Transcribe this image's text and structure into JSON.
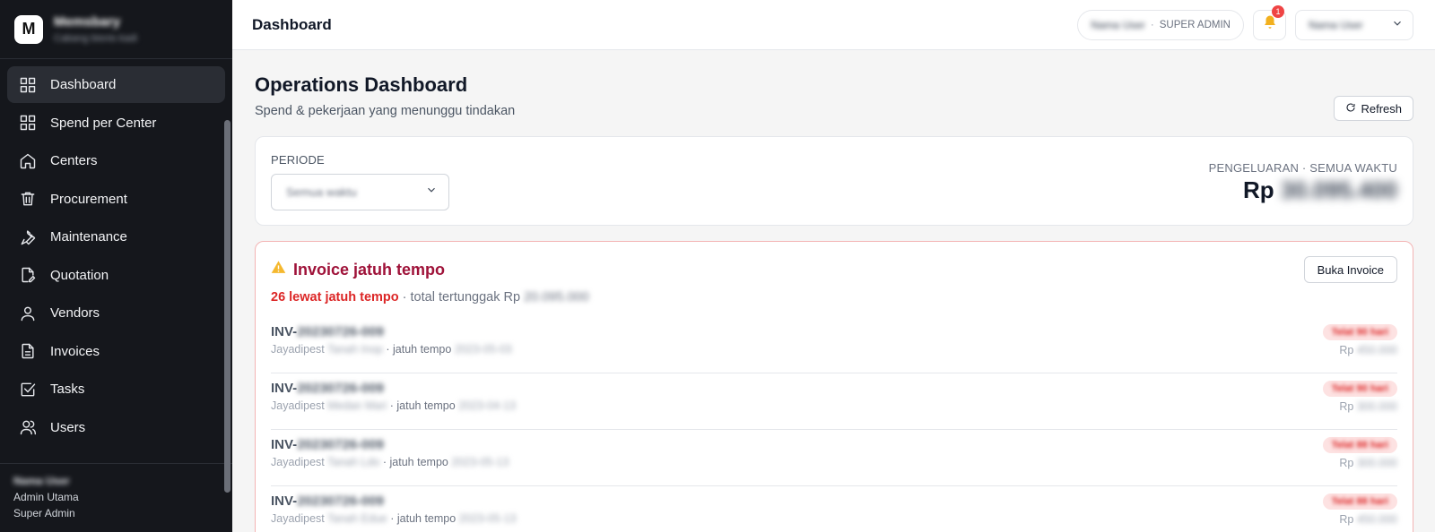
{
  "brand": {
    "logo_letter": "M",
    "name": "Memsbary",
    "subtitle": "Cabang bisnis kadi"
  },
  "sidebar": {
    "items": [
      {
        "label": "Dashboard",
        "icon": "grid-icon",
        "active": true
      },
      {
        "label": "Spend per Center",
        "icon": "grid-icon"
      },
      {
        "label": "Centers",
        "icon": "home-icon"
      },
      {
        "label": "Procurement",
        "icon": "trash-icon"
      },
      {
        "label": "Maintenance",
        "icon": "wrench-icon"
      },
      {
        "label": "Quotation",
        "icon": "file-edit-icon"
      },
      {
        "label": "Vendors",
        "icon": "user-icon"
      },
      {
        "label": "Invoices",
        "icon": "file-text-icon"
      },
      {
        "label": "Tasks",
        "icon": "checkbox-icon"
      },
      {
        "label": "Users",
        "icon": "users-icon"
      }
    ],
    "footer": {
      "name": "Nama User",
      "org": "Admin Utama",
      "role": "Super Admin"
    }
  },
  "topbar": {
    "title": "Dashboard",
    "user_name": "Nama User",
    "role_sep": "·",
    "role": "SUPER ADMIN",
    "notification_count": "1",
    "account_select": "Nama User"
  },
  "page": {
    "title": "Operations Dashboard",
    "subtitle": "Spend & pekerjaan yang menunggu tindakan",
    "refresh_label": "Refresh"
  },
  "period": {
    "label": "PERIODE",
    "selected": "Semua waktu",
    "spend_label": "PENGELUARAN · SEMUA WAKTU",
    "spend_prefix": "Rp",
    "spend_value": "30.095.400"
  },
  "invoices": {
    "title": "Invoice jatuh tempo",
    "open_button": "Buka Invoice",
    "overdue_text": "26 lewat jatuh tempo",
    "total_text": "· total tertunggak Rp",
    "total_value": "20.095.000",
    "rows": [
      {
        "prefix": "INV-",
        "number": "20230726-009",
        "vendor": "Jayadipest",
        "center": "Tanah Inop",
        "due_label": "· jatuh tempo",
        "due": "2023-05-03",
        "late": "Telat 90 hari",
        "amount_prefix": "Rp",
        "amount": "450.000"
      },
      {
        "prefix": "INV-",
        "number": "20230726-009",
        "vendor": "Jayadipest",
        "center": "Medan Mari",
        "due_label": "· jatuh tempo",
        "due": "2023-04-13",
        "late": "Telat 90 hari",
        "amount_prefix": "Rp",
        "amount": "300.000"
      },
      {
        "prefix": "INV-",
        "number": "20230726-009",
        "vendor": "Jayadipest",
        "center": "Tanah Ldo",
        "due_label": "· jatuh tempo",
        "due": "2023-05-13",
        "late": "Telat 88 hari",
        "amount_prefix": "Rp",
        "amount": "300.000"
      },
      {
        "prefix": "INV-",
        "number": "20230726-009",
        "vendor": "Jayadipest",
        "center": "Tanah Edue",
        "due_label": "· jatuh tempo",
        "due": "2023-05-13",
        "late": "Telat 88 hari",
        "amount_prefix": "Rp",
        "amount": "450.000"
      }
    ]
  }
}
